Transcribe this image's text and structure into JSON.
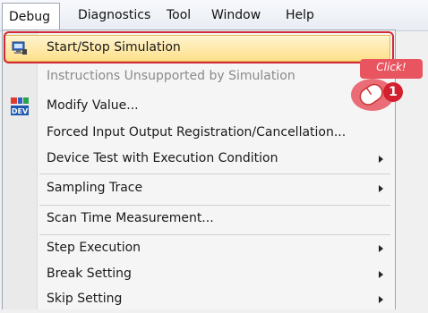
{
  "menubar": {
    "debug": "Debug",
    "diagnostics": "Diagnostics",
    "tool": "Tool",
    "window": "Window",
    "help": "Help"
  },
  "menu": {
    "start_stop_simulation": "Start/Stop Simulation",
    "instructions_unsupported": "Instructions Unsupported by Simulation",
    "modify_value": "Modify Value...",
    "forced_io": "Forced Input Output Registration/Cancellation...",
    "device_test": "Device Test with Execution Condition",
    "sampling_trace": "Sampling Trace",
    "scan_time": "Scan Time Measurement...",
    "step_execution": "Step Execution",
    "break_setting": "Break Setting",
    "skip_setting": "Skip Setting"
  },
  "callout": {
    "click_text": "Click!",
    "step_number": "1"
  },
  "colors": {
    "highlight": "#ffe08a",
    "frame": "#d22a3a",
    "callout": "#e8545f"
  }
}
